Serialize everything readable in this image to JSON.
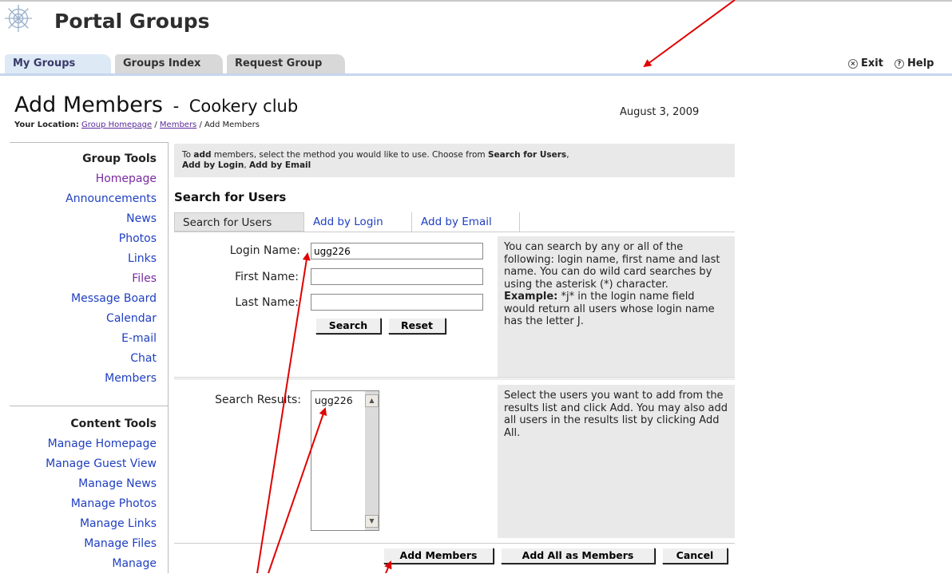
{
  "header": {
    "title": "Portal Groups"
  },
  "tabs": [
    {
      "label": "My Groups",
      "active": true
    },
    {
      "label": "Groups Index",
      "active": false
    },
    {
      "label": "Request Group",
      "active": false
    }
  ],
  "topright": {
    "exit": "Exit",
    "help": "Help"
  },
  "page": {
    "title": "Add Members",
    "separator": "-",
    "group_name": "Cookery club",
    "date": "August 3, 2009",
    "location_label": "Your Location:",
    "crumb_home": "Group Homepage",
    "crumb_sep1": "/",
    "crumb_members": "Members",
    "crumb_sep2": "/",
    "crumb_current": "Add Members"
  },
  "sidebar": {
    "group_tools_heading": "Group Tools",
    "group_tools": [
      "Homepage",
      "Announcements",
      "News",
      "Photos",
      "Links",
      "Files",
      "Message Board",
      "Calendar",
      "E-mail",
      "Chat",
      "Members"
    ],
    "content_tools_heading": "Content Tools",
    "content_tools": [
      "Manage Homepage",
      "Manage Guest View",
      "Manage News",
      "Manage Photos",
      "Manage Links",
      "Manage Files",
      "Manage"
    ]
  },
  "instructions": {
    "p1": "To ",
    "b1": "add",
    "p2": " members, select the method you would like to use. Choose from ",
    "b2": "Search for Users",
    "p3": ",",
    "b3": "Add by Login",
    "p4": ", ",
    "b4": "Add by Email"
  },
  "section_title": "Search for Users",
  "method_tabs": [
    "Search for Users",
    "Add by Login",
    "Add by Email"
  ],
  "form": {
    "login_label": "Login Name:",
    "login_value": "ugg226",
    "first_label": "First Name:",
    "first_value": "",
    "last_label": "Last Name:",
    "last_value": "",
    "search_button": "Search",
    "reset_button": "Reset",
    "hint_text": "You can search by any or all of the following: login name, first name and last name. You can do wild card searches by using the asterisk (*) character.",
    "hint_example_label": "Example:",
    "hint_example_text": " *j* in the login name field would return all users whose login name has the letter J."
  },
  "results": {
    "label": "Search Results:",
    "items": [
      "ugg226"
    ],
    "hint_text": "Select the users you want to add from the results list and click Add. You may also add all users in the results list by clicking Add All."
  },
  "actions": {
    "add_members": "Add Members",
    "add_all": "Add All as Members",
    "cancel": "Cancel"
  },
  "colors": {
    "annotation_arrow": "#e00000",
    "link": "#1f3fc0",
    "visited_link": "#7a2aa0"
  }
}
